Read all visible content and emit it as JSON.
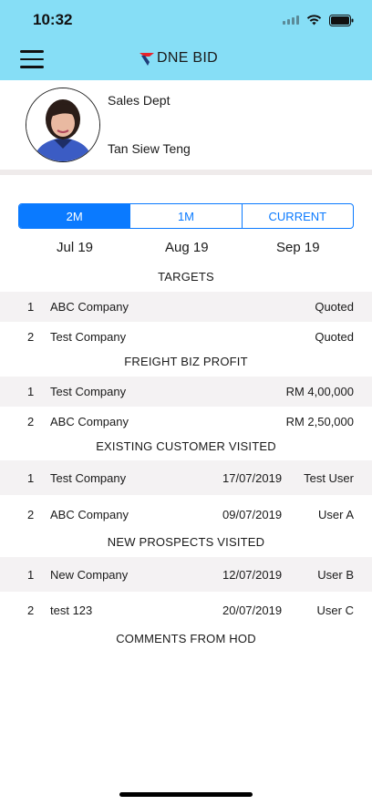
{
  "status": {
    "time": "10:32"
  },
  "header": {
    "logo_text": "DNE BID"
  },
  "profile": {
    "dept": "Sales Dept",
    "name": "Tan Siew Teng"
  },
  "tabs": [
    {
      "label": "2M",
      "active": true
    },
    {
      "label": "1M",
      "active": false
    },
    {
      "label": "CURRENT",
      "active": false
    }
  ],
  "months": [
    "Jul 19",
    "Aug 19",
    "Sep 19"
  ],
  "sections": {
    "targets": {
      "title": "TARGETS",
      "rows": [
        {
          "idx": "1",
          "name": "ABC Company",
          "value": "Quoted"
        },
        {
          "idx": "2",
          "name": "Test Company",
          "value": "Quoted"
        }
      ]
    },
    "freight": {
      "title": "FREIGHT BIZ PROFIT",
      "rows": [
        {
          "idx": "1",
          "name": "Test Company",
          "value": "RM 4,00,000"
        },
        {
          "idx": "2",
          "name": "ABC Company",
          "value": "RM 2,50,000"
        }
      ]
    },
    "existing": {
      "title": "EXISTING CUSTOMER VISITED",
      "rows": [
        {
          "idx": "1",
          "name": "Test Company",
          "date": "17/07/2019",
          "user": "Test User"
        },
        {
          "idx": "2",
          "name": "ABC Company",
          "date": "09/07/2019",
          "user": "User A"
        }
      ]
    },
    "prospects": {
      "title": "NEW PROSPECTS VISITED",
      "rows": [
        {
          "idx": "1",
          "name": "New Company",
          "date": "12/07/2019",
          "user": "User B"
        },
        {
          "idx": "2",
          "name": "test 123",
          "date": "20/07/2019",
          "user": "User C"
        }
      ]
    },
    "comments": {
      "title": "COMMENTS FROM HOD"
    }
  },
  "colors": {
    "header_bg": "#86def6",
    "accent": "#0a7aff",
    "row_shade": "#f4f2f3",
    "logo_red": "#e8232b",
    "logo_blue": "#1f3d7a"
  },
  "icons": [
    "menu-icon",
    "signal-icon",
    "wifi-icon",
    "battery-icon",
    "logo-icon",
    "avatar"
  ]
}
